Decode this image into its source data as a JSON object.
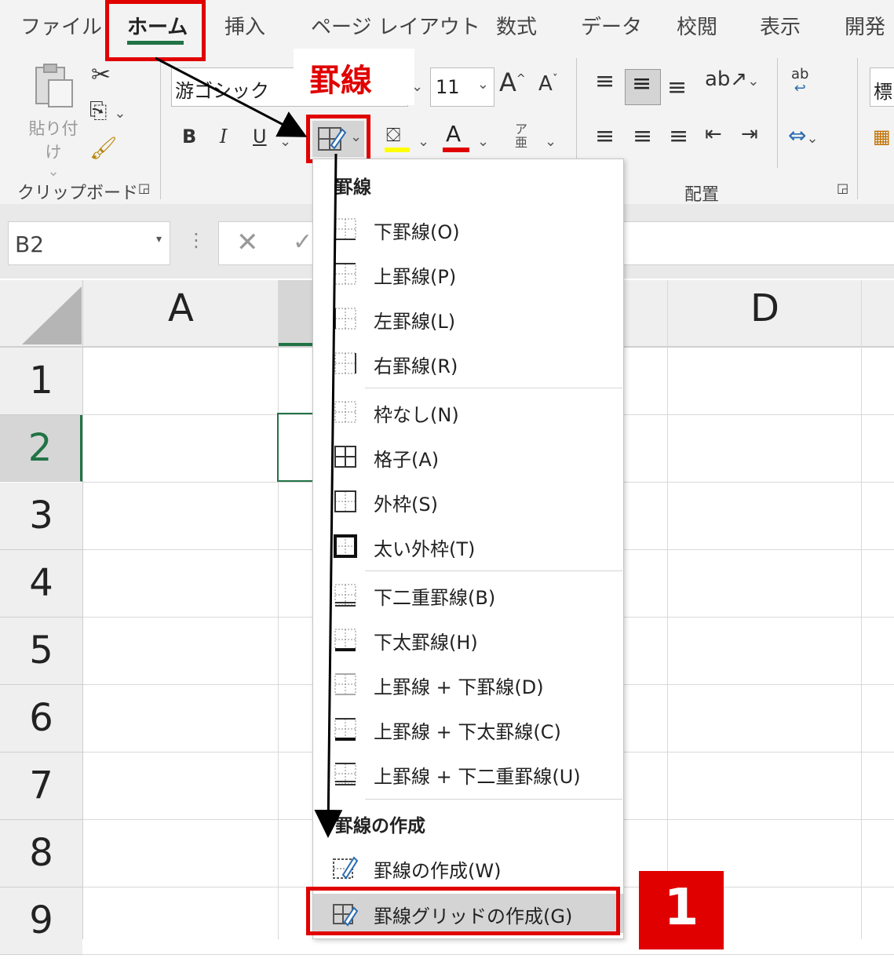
{
  "tabs": [
    {
      "label": "ファイル"
    },
    {
      "label": "ホーム"
    },
    {
      "label": "挿入"
    },
    {
      "label": "ページ レイアウト"
    },
    {
      "label": "数式"
    },
    {
      "label": "データ"
    },
    {
      "label": "校閲"
    },
    {
      "label": "表示"
    },
    {
      "label": "開発"
    }
  ],
  "ribbon": {
    "paste_label": "貼り付け",
    "clipboard_label": "クリップボード",
    "font_name": "游ゴシック",
    "font_size": "11",
    "grow_font": "A",
    "shrink_font": "A",
    "bold": "B",
    "italic": "I",
    "underline": "U",
    "font_color_letter": "A",
    "phonetic": "ア\n亜",
    "alignment_label": "配置",
    "style_label": "標",
    "wrap_text": "ab"
  },
  "callout": {
    "label": "罫線",
    "step_number": "1"
  },
  "namebox": {
    "value": "B2"
  },
  "columns": [
    "A",
    "D"
  ],
  "rows": [
    "1",
    "2",
    "3",
    "4",
    "5",
    "6",
    "7",
    "8",
    "9"
  ],
  "menu": {
    "section1": "罫線",
    "items1": [
      {
        "label": "下罫線(O)",
        "icon": "border-bottom-icon"
      },
      {
        "label": "上罫線(P)",
        "icon": "border-top-icon"
      },
      {
        "label": "左罫線(L)",
        "icon": "border-left-icon"
      },
      {
        "label": "右罫線(R)",
        "icon": "border-right-icon"
      }
    ],
    "items2": [
      {
        "label": "枠なし(N)",
        "icon": "no-border-icon"
      },
      {
        "label": "格子(A)",
        "icon": "all-borders-icon"
      },
      {
        "label": "外枠(S)",
        "icon": "outside-borders-icon"
      },
      {
        "label": "太い外枠(T)",
        "icon": "thick-outside-borders-icon"
      }
    ],
    "items3": [
      {
        "label": "下二重罫線(B)",
        "icon": "bottom-double-border-icon"
      },
      {
        "label": "下太罫線(H)",
        "icon": "thick-bottom-border-icon"
      },
      {
        "label": "上罫線 + 下罫線(D)",
        "icon": "top-bottom-border-icon"
      },
      {
        "label": "上罫線 + 下太罫線(C)",
        "icon": "top-thick-bottom-border-icon"
      },
      {
        "label": "上罫線 + 下二重罫線(U)",
        "icon": "top-double-bottom-border-icon"
      }
    ],
    "section2": "罫線の作成",
    "draw_border": "罫線の作成(W)",
    "draw_border_grid": "罫線グリッドの作成(G)"
  },
  "colors": {
    "accent": "#217346",
    "highlight": "#e00000",
    "font_color": "#e00000",
    "fill_color": "#ffff00",
    "hover": "#d4d4d4"
  }
}
